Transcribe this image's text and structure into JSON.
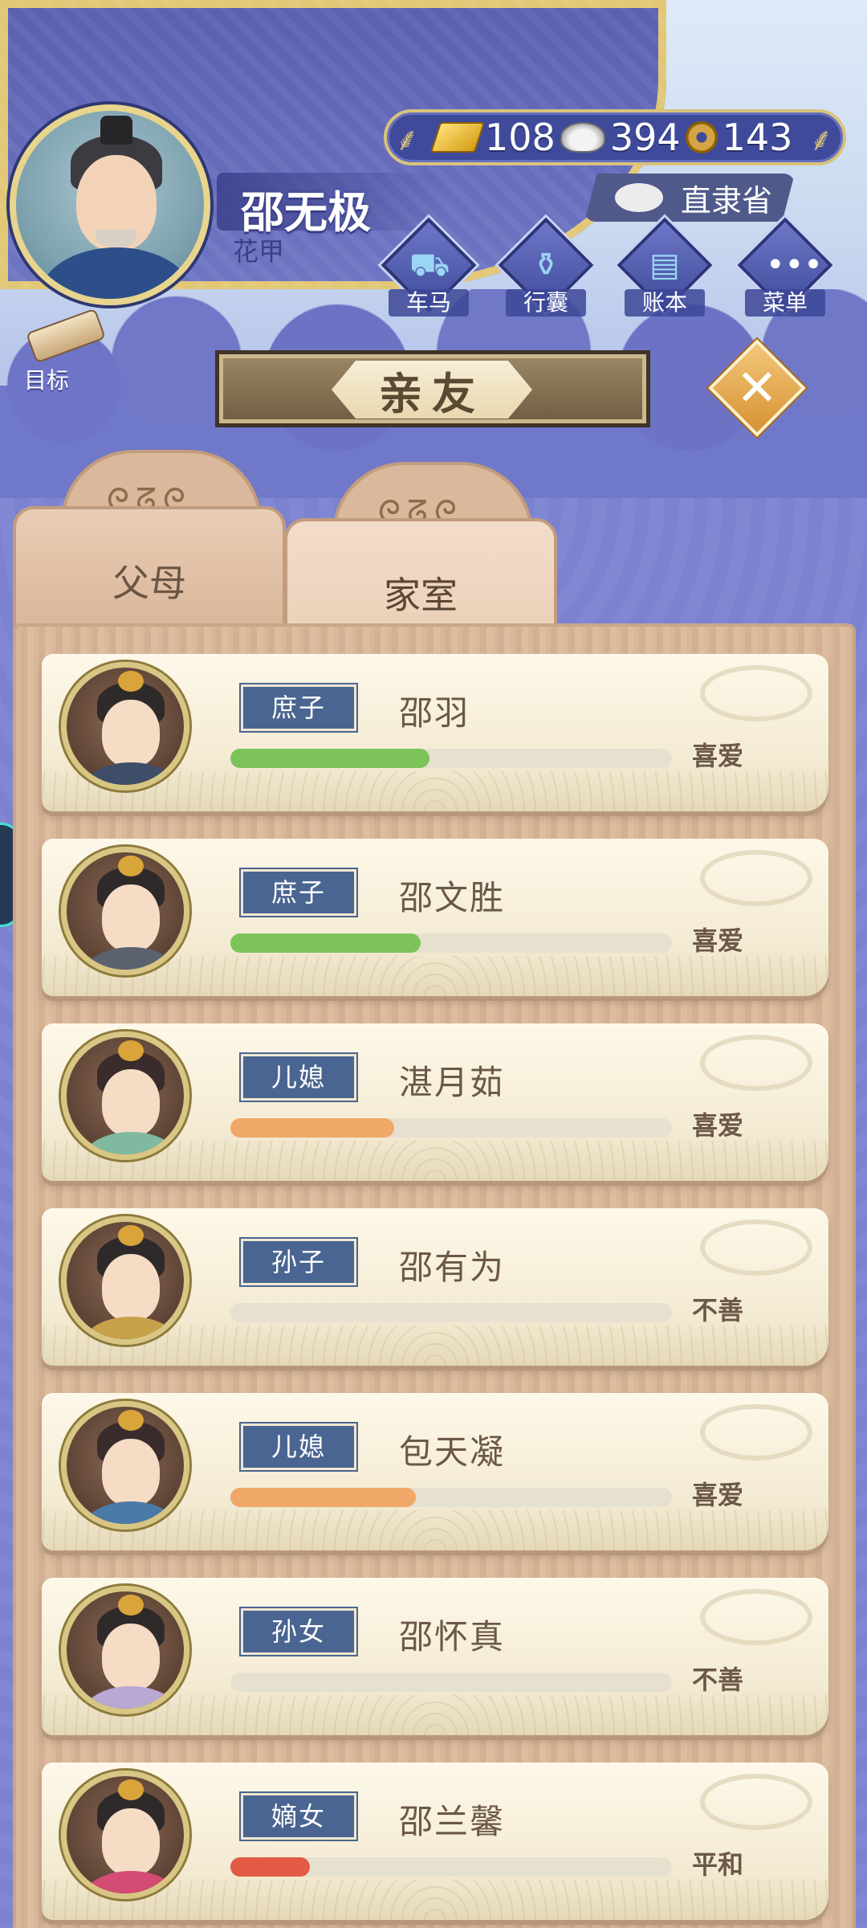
{
  "player": {
    "name": "邵无极",
    "age_label": "花甲"
  },
  "currency": {
    "gold": "108",
    "silver": "394",
    "coins": "143"
  },
  "location": "直隶省",
  "nav": [
    {
      "label": "车马",
      "icon": "carriage-icon"
    },
    {
      "label": "行囊",
      "icon": "bundle-icon"
    },
    {
      "label": "账本",
      "icon": "ledger-icon"
    },
    {
      "label": "菜单",
      "icon": "more-dots-icon"
    }
  ],
  "goal_label": "目标",
  "title": "亲友",
  "tabs": [
    {
      "label": "父母",
      "active": false
    },
    {
      "label": "家室",
      "active": true
    }
  ],
  "relatives": [
    {
      "role": "庶子",
      "name": "邵羽",
      "relation": "喜爱",
      "affinity": 0.45,
      "bar_color": "#7cc45a"
    },
    {
      "role": "庶子",
      "name": "邵文胜",
      "relation": "喜爱",
      "affinity": 0.43,
      "bar_color": "#7cc45a"
    },
    {
      "role": "儿媳",
      "name": "湛月茹",
      "relation": "喜爱",
      "affinity": 0.37,
      "bar_color": "#f0a868"
    },
    {
      "role": "孙子",
      "name": "邵有为",
      "relation": "不善",
      "affinity": 0.0,
      "bar_color": "#e6e0cf"
    },
    {
      "role": "儿媳",
      "name": "包天凝",
      "relation": "喜爱",
      "affinity": 0.42,
      "bar_color": "#f0a868"
    },
    {
      "role": "孙女",
      "name": "邵怀真",
      "relation": "不善",
      "affinity": 0.0,
      "bar_color": "#e6e0cf"
    },
    {
      "role": "嫡女",
      "name": "邵兰馨",
      "relation": "平和",
      "affinity": 0.18,
      "bar_color": "#e35a45"
    }
  ],
  "colors": {
    "accent_gold": "#d9c27c",
    "banner_blue": "#5a5fb0",
    "badge_blue": "#4a6591"
  }
}
